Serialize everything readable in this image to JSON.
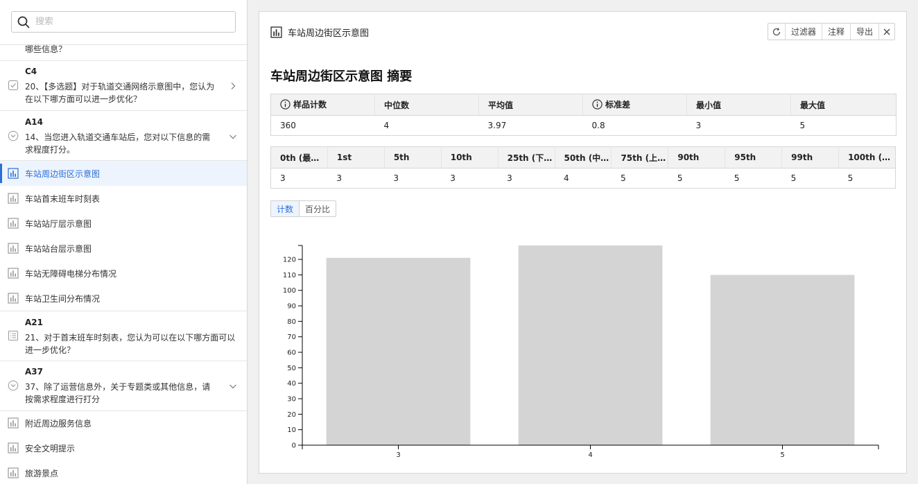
{
  "sidebar": {
    "search_placeholder": "搜索",
    "partial_text": "哪些信息？",
    "questions": [
      {
        "code": "C4",
        "text": "20、【多选题】对于轨道交通网络示意图中，您认为在以下哪方面可以进一步优化？",
        "icon": "checkbox-icon",
        "chevron": "chevron-right-icon"
      },
      {
        "code": "A14",
        "text": "14、当您进入轨道交通车站后，您对以下信息的需求程度打分。",
        "icon": "circle-chevron-icon",
        "chevron": "chevron-down-icon"
      },
      {
        "code": "A21",
        "text": "21、对于首末班车时刻表，您认为可以在以下哪方面可以进一步优化？",
        "icon": "list-icon"
      },
      {
        "code": "A37",
        "text": "37、除了运营信息外，关于专题类或其他信息，请按需求程度进行打分",
        "icon": "circle-chevron-icon",
        "chevron": "chevron-down-icon"
      }
    ],
    "charts_a14": [
      "车站周边街区示意图",
      "车站首末班车时刻表",
      "车站站厅层示意图",
      "车站站台层示意图",
      "车站无障碍电梯分布情况",
      "车站卫生间分布情况"
    ],
    "charts_a37": [
      "附近周边服务信息",
      "安全文明提示",
      "旅游景点"
    ],
    "active_item": "车站周边街区示意图"
  },
  "panel": {
    "title": "车站周边街区示意图",
    "toolbar": {
      "filter": "过滤器",
      "annotate": "注释",
      "export": "导出"
    },
    "summary_title": "车站周边街区示意图 摘要",
    "stats": {
      "headers": [
        "样品计数",
        "中位数",
        "平均值",
        "标准差",
        "最小值",
        "最大值"
      ],
      "values": [
        "360",
        "4",
        "3.97",
        "0.8",
        "3",
        "5"
      ]
    },
    "percentiles": {
      "headers": [
        "0th (最…",
        "1st",
        "5th",
        "10th",
        "25th (下…",
        "50th (中…",
        "75th (上…",
        "90th",
        "95th",
        "99th",
        "100th (…"
      ],
      "values": [
        "3",
        "3",
        "3",
        "3",
        "3",
        "4",
        "5",
        "5",
        "5",
        "5",
        "5"
      ]
    },
    "toggle": {
      "count": "计数",
      "percent": "百分比",
      "selected": "count"
    }
  },
  "chart_data": {
    "type": "bar",
    "categories": [
      "3",
      "4",
      "5"
    ],
    "values": [
      121,
      129,
      110
    ],
    "ylim": [
      0,
      129
    ],
    "yticks": [
      0,
      10,
      20,
      30,
      40,
      50,
      60,
      70,
      80,
      90,
      100,
      110,
      120
    ],
    "bar_color": "#d4d4d4",
    "grid": false,
    "xlabel": "",
    "ylabel": ""
  },
  "colors": {
    "accent": "#2a6fd8"
  }
}
